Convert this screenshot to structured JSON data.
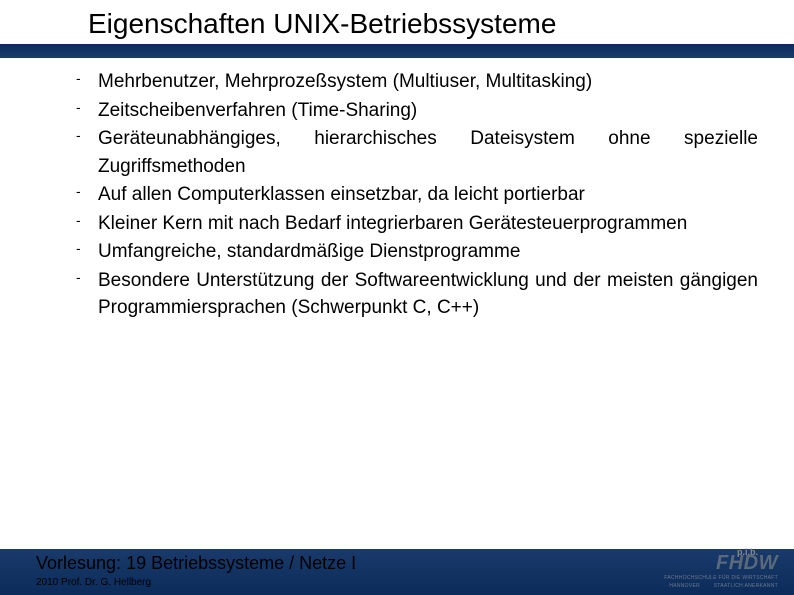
{
  "title": "Eigenschaften UNIX-Betriebssysteme",
  "bullets": [
    "Mehrbenutzer, Mehrprozeßsystem (Multiuser, Multitasking)",
    "Zeitscheibenverfahren (Time-Sharing)",
    "Geräteunabhängiges, hierarchisches Dateisystem ohne spezielle Zugriffsmethoden",
    "Auf allen Computerklassen einsetzbar, da leicht portierbar",
    "Kleiner Kern mit nach Bedarf integrierbaren Gerätesteuerprogrammen",
    "Umfangreiche, standardmäßige Dienstprogramme",
    "Besondere Unterstützung der Softwareentwicklung und der meisten gängigen Programmiersprachen (Schwerpunkt C, C++)"
  ],
  "footer": {
    "lecture_label": "Vorlesung:",
    "lecture_value": "19 Betriebssysteme / Netze I",
    "copyright": "2010 Prof. Dr. G. Hellberg"
  },
  "logo": {
    "pib": "p.i.b.",
    "main": "FHDW",
    "sub1": "FACHHOCHSCHULE FÜR DIE WIRTSCHAFT",
    "sub2": "HANNOVER",
    "sub3": "STAATLICH ANERKANNT"
  }
}
